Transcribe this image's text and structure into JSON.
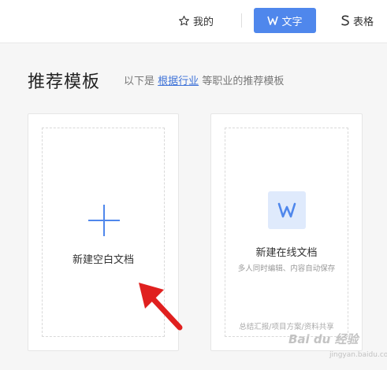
{
  "nav": {
    "mine_label": "我的",
    "doc_label": "文字",
    "sheet_label": "表格"
  },
  "page": {
    "title": "推荐模板",
    "subtitle_prefix": "以下是",
    "subtitle_link": "根据行业",
    "subtitle_suffix": "等职业的推荐模板"
  },
  "cards": {
    "blank": {
      "label": "新建空白文档"
    },
    "online": {
      "label": "新建在线文档",
      "description": "多人同时编辑、内容自动保存",
      "tags": "总结汇报/项目方案/资料共享"
    }
  },
  "watermark": {
    "text": "Bai du 经验",
    "sub": "jingyan.baidu.com"
  },
  "colors": {
    "accent": "#4f87ec",
    "arrow": "#e0201f"
  },
  "icons": [
    "star-icon",
    "w-doc-icon",
    "s-sheet-icon",
    "plus-icon",
    "red-arrow-icon"
  ]
}
